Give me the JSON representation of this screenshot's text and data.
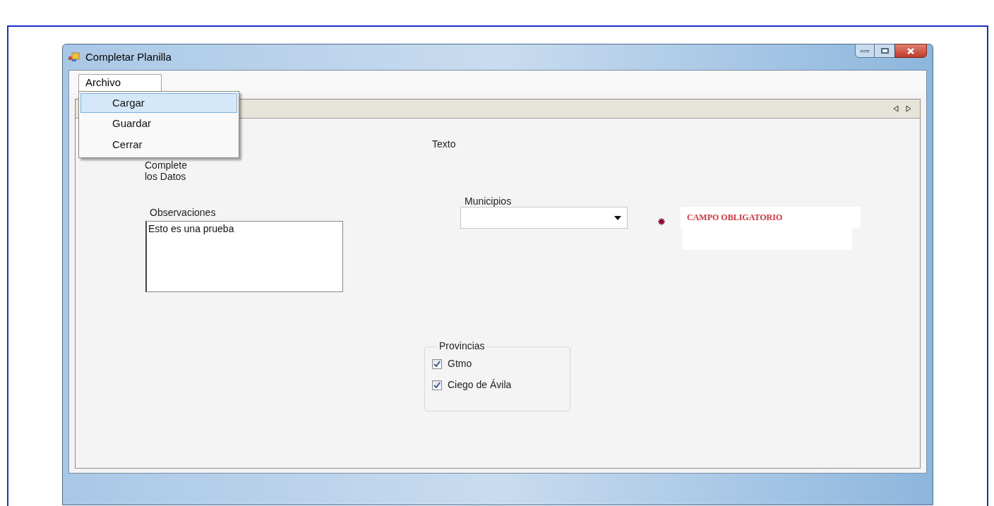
{
  "window": {
    "title": "Completar Planilla"
  },
  "menu": {
    "label": "Archivo",
    "expanded": true,
    "items": [
      {
        "label": "Cargar",
        "selected": true
      },
      {
        "label": "Guardar",
        "selected": false
      },
      {
        "label": "Cerrar",
        "selected": false
      }
    ]
  },
  "form": {
    "heading": "Complete\nlos Datos",
    "text_label": "Texto",
    "observaciones": {
      "label": "Observaciones",
      "value": "Esto es una prueba"
    },
    "municipios": {
      "label": "Municipios"
    },
    "required_message": "CAMPO OBLIGATORIO",
    "provincias": {
      "label": "Provincias",
      "items": [
        {
          "label": "Gtmo",
          "checked": true
        },
        {
          "label": "Ciego de Ávila",
          "checked": true
        }
      ]
    }
  }
}
